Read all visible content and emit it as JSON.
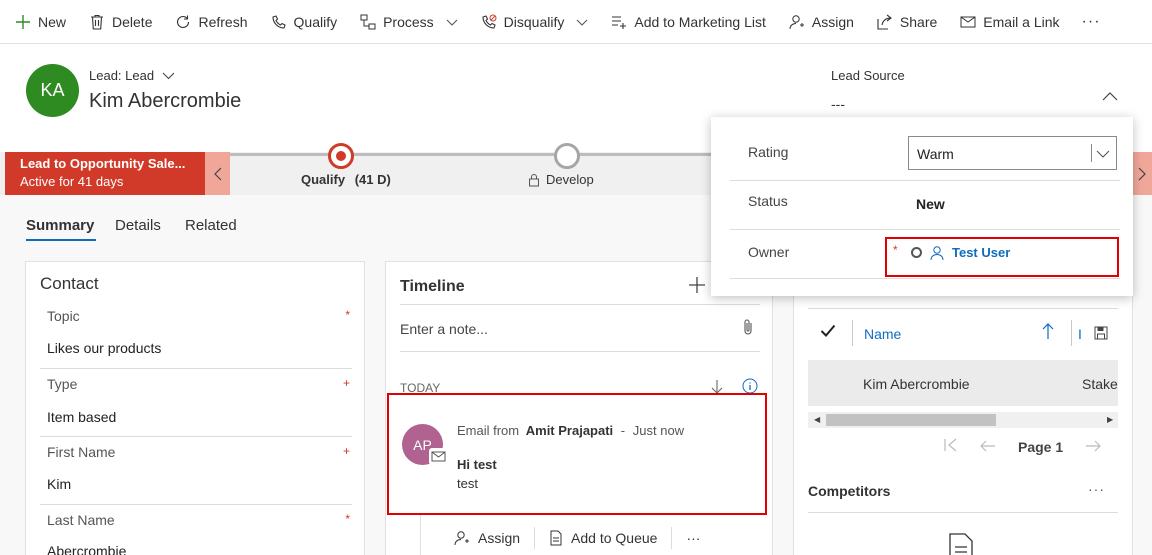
{
  "commandbar": {
    "new": "New",
    "delete": "Delete",
    "refresh": "Refresh",
    "qualify": "Qualify",
    "process": "Process",
    "disqualify": "Disqualify",
    "add_to_marketing_list": "Add to Marketing List",
    "assign": "Assign",
    "share": "Share",
    "email_a_link": "Email a Link",
    "more": "···"
  },
  "header": {
    "avatar_initials": "KA",
    "avatar_color": "#2e8b22",
    "entity_type": "Lead: Lead",
    "record_name": "Kim Abercrombie",
    "lead_source_label": "Lead Source",
    "lead_source_value": "---"
  },
  "bpf": {
    "process_name": "Lead to Opportunity Sale...",
    "active_for": "Active for 41 days",
    "active_stage": "Qualify",
    "active_stage_days": "(41 D)",
    "next_stage": "Develop",
    "accent_color": "#d13a28"
  },
  "tabs": [
    {
      "label": "Summary",
      "active": true
    },
    {
      "label": "Details",
      "active": false
    },
    {
      "label": "Related",
      "active": false
    }
  ],
  "contact": {
    "title": "Contact",
    "fields": [
      {
        "label": "Topic",
        "value": "Likes our products",
        "required": "*"
      },
      {
        "label": "Type",
        "value": "Item based",
        "required": "+"
      },
      {
        "label": "First Name",
        "value": "Kim",
        "required": "+"
      },
      {
        "label": "Last Name",
        "value": "Abercrombie",
        "required": "*"
      }
    ]
  },
  "timeline": {
    "title": "Timeline",
    "note_placeholder": "Enter a note...",
    "group_label": "TODAY",
    "item": {
      "avatar_initials": "AP",
      "avatar_color": "#b06291",
      "prefix": "Email from",
      "from": "Amit Prajapati",
      "separator": "-",
      "time": "Just now",
      "subject": "Hi test",
      "body": "test"
    },
    "actions": {
      "assign": "Assign",
      "add_to_queue": "Add to Queue",
      "more": "···"
    }
  },
  "stakeholders": {
    "column_name": "Name",
    "column_partial": "I",
    "row_name": "Kim Abercrombie",
    "row_role": "Stake",
    "page_label": "Page 1",
    "competitors_title": "Competitors",
    "competitors_more": "···"
  },
  "flyout": {
    "rating_label": "Rating",
    "rating_value": "Warm",
    "status_label": "Status",
    "status_value": "New",
    "owner_label": "Owner",
    "owner_required": "*",
    "owner_value": "Test User"
  }
}
